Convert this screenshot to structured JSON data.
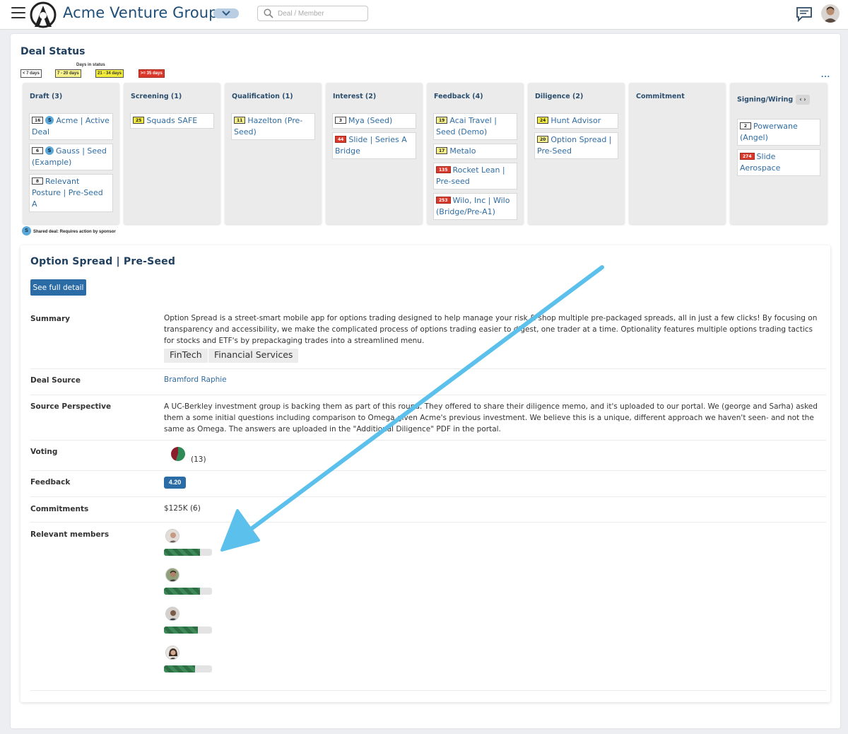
{
  "header": {
    "brand": "Acme Venture Group",
    "search_placeholder": "Deal / Member"
  },
  "deal_status": {
    "title": "Deal Status",
    "legend_title": "Days in status",
    "legend": [
      "< 7 days",
      "7 - 20 days",
      "21 - 34 days",
      ">= 35 days"
    ],
    "more": "..."
  },
  "columns": [
    {
      "title": "Draft (3)",
      "cards": [
        {
          "badge": "16",
          "shared": true,
          "shared_label": "S",
          "text": "Acme | Active Deal"
        },
        {
          "badge": "6",
          "shared": true,
          "shared_label": "S",
          "text": "Gauss | Seed (Example)"
        },
        {
          "badge": "8",
          "text": "Relevant Posture | Pre-Seed A"
        }
      ]
    },
    {
      "title": "Screening (1)",
      "cards": [
        {
          "badge": "25",
          "text": "Squads SAFE"
        }
      ]
    },
    {
      "title": "Qualification (1)",
      "cards": [
        {
          "badge": "11",
          "text": "Hazelton (Pre-Seed)"
        }
      ]
    },
    {
      "title": "Interest (2)",
      "cards": [
        {
          "badge": "3",
          "text": "Mya (Seed)"
        },
        {
          "badge": "44",
          "text": "Slide | Series A Bridge"
        }
      ]
    },
    {
      "title": "Feedback (4)",
      "cards": [
        {
          "badge": "19",
          "text": "Acai Travel | Seed (Demo)"
        },
        {
          "badge": "17",
          "text": "Metalo"
        },
        {
          "badge": "135",
          "text": "Rocket Lean | Pre-seed"
        },
        {
          "badge": "253",
          "text": "Wilo, Inc | Wilo (Bridge/Pre-A1)"
        }
      ]
    },
    {
      "title": "Diligence (2)",
      "cards": [
        {
          "badge": "24",
          "text": "Hunt Advisor"
        },
        {
          "badge": "20",
          "text": "Option Spread | Pre-Seed"
        }
      ]
    },
    {
      "title": "Commitment",
      "cards": []
    },
    {
      "title": "Signing/Wiring",
      "nav": "‹ ›",
      "cards": [
        {
          "badge": "2",
          "text": "Powerwane (Angel)"
        },
        {
          "badge": "274",
          "text": "Slide Aerospace"
        }
      ]
    }
  ],
  "shared_note": {
    "icon_label": "S",
    "text": "Shared deal: Requires action by sponsor"
  },
  "detail": {
    "title": "Option Spread | Pre-Seed",
    "full_detail_button": "See full detail",
    "summary_label": "Summary",
    "summary": "Option Spread is a street-smart mobile app for options trading designed to help manage your risk & shop multiple pre-packaged spreads, all in just a few clicks! By focusing on transparency and accessibility, we make the complicated process of options trading easier to digest, one trader at a time. Optionality features multiple options trading tactics for stocks and ETF's by prepackaging trades into a streamlined menu.",
    "tags": [
      "FinTech",
      "Financial Services"
    ],
    "deal_source_label": "Deal Source",
    "deal_source": "Bramford Raphie",
    "source_perspective_label": "Source Perspective",
    "source_perspective": "A UC-Berkley investment group  is backing them as part of this round. They offered to share their diligence memo, and it's uploaded to our portal. We (george and Sarha) asked them a some initial questions including comparison to Omega given Acme's previous investment. We believe this is a unique, different approach we haven't seen- and not the same as Omega. The answers are uploaded in the \"Additional Diligence\" PDF in the portal.",
    "voting_label": "Voting",
    "voting_count": "(13)",
    "voting_split": {
      "green": 0.55,
      "red": 0.45
    },
    "feedback_label": "Feedback",
    "feedback_score": "4.20",
    "commitments_label": "Commitments",
    "commitments": "$125K (6)",
    "members_label": "Relevant members",
    "member_progress": [
      0.75,
      0.75,
      0.7,
      0.65
    ]
  },
  "colors": {
    "primary": "#2b6ca6",
    "link": "#2f6ca3",
    "badge_white": "#ffffff",
    "badge_light_yellow": "#f7f18a",
    "badge_yellow": "#f4ec3a",
    "badge_red": "#d9382b",
    "arrow": "#5bc0eb"
  }
}
